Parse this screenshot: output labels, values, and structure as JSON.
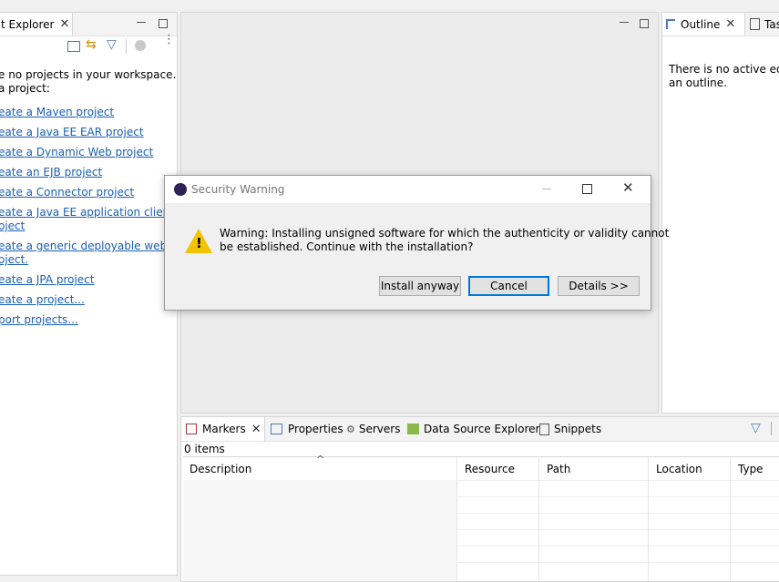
{
  "project_explorer": {
    "tab_title": "t Explorer",
    "empty_message_line1": "e no projects in your workspace.",
    "empty_message_line2": "a project:",
    "links": [
      "eate a Maven project",
      "eate a Java EE EAR project",
      "eate a Dynamic Web project",
      "eate an EJB project",
      "eate a Connector project",
      "eate a Java EE application client ",
      "oject",
      "eate a generic deployable web ",
      "oject.",
      "eate a JPA project",
      "eate a project...",
      "port projects..."
    ]
  },
  "outline": {
    "tab_title": "Outline",
    "second_tab": "Tas",
    "message_line1": "There is no active edito",
    "message_line2": "an outline."
  },
  "bottom_panel": {
    "tabs": [
      "Markers",
      "Properties",
      "Servers",
      "Data Source Explorer",
      "Snippets"
    ],
    "item_count": "0 items",
    "sort_indicator": "^",
    "columns": [
      "Description",
      "Resource",
      "Path",
      "Location",
      "Type"
    ]
  },
  "dialog": {
    "title": "Security Warning",
    "message_line1": "Warning: Installing unsigned software for which the authenticity or validity cannot",
    "message_line2": "be established. Continue with the installation?",
    "buttons": {
      "install": "Install anyway",
      "cancel": "Cancel",
      "details": "Details >>"
    }
  },
  "colors": {
    "link": "#1a5fb4",
    "default_button_border": "#0078d7",
    "warning_yellow": "#f5c400"
  }
}
